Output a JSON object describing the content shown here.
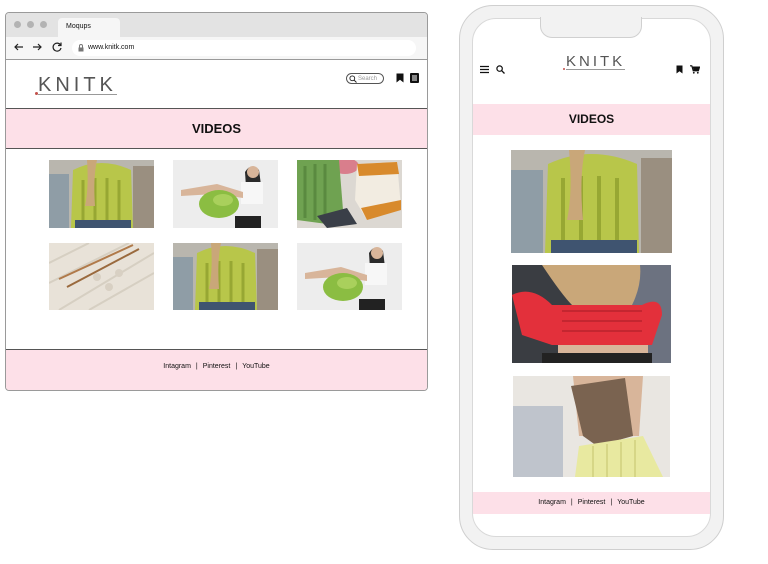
{
  "browser": {
    "tab_title": "Moqups",
    "url": "www.knitk.com"
  },
  "site": {
    "logo_text": "KNITK",
    "search_placeholder": "Search",
    "page_title": "VIDEOS",
    "footer_links": [
      "Intagram",
      "Pinterest",
      "YouTube"
    ]
  },
  "desktop": {
    "videos": [
      {
        "subject": "green-cable-knit-vest"
      },
      {
        "subject": "green-knit-bag-model"
      },
      {
        "subject": "knit-swatches-flatlay"
      },
      {
        "subject": "white-knit-with-needles"
      },
      {
        "subject": "green-cable-knit-vest"
      },
      {
        "subject": "green-knit-bag-model"
      }
    ]
  },
  "mobile": {
    "videos": [
      {
        "subject": "green-cable-knit-vest"
      },
      {
        "subject": "red-knit-top"
      },
      {
        "subject": "brown-knit-bag-yellow-skirt"
      }
    ]
  },
  "icons": {
    "menu": "menu-icon",
    "search": "search-icon",
    "bookmark": "bookmark-icon",
    "list": "list-icon",
    "cart": "cart-icon"
  },
  "colors": {
    "banner_pink": "#fde0e8",
    "logo_accent": "#c2504a"
  }
}
